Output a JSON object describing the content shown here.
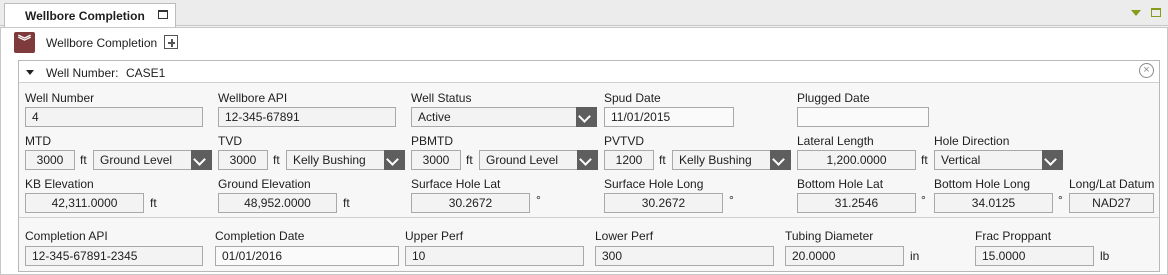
{
  "tab": {
    "title": "Wellbore Completion"
  },
  "section": {
    "title": "Wellbore Completion"
  },
  "group": {
    "label": "Well Number:",
    "value": "CASE1"
  },
  "fields": {
    "well_number": {
      "label": "Well Number",
      "value": "4"
    },
    "wellbore_api": {
      "label": "Wellbore API",
      "value": "12-345-67891"
    },
    "well_status": {
      "label": "Well Status",
      "value": "Active"
    },
    "spud_date": {
      "label": "Spud Date",
      "value": "11/01/2015"
    },
    "plugged_date": {
      "label": "Plugged Date",
      "value": ""
    },
    "mtd": {
      "label": "MTD",
      "value": "3000",
      "unit": "ft",
      "ref": "Ground Level"
    },
    "tvd": {
      "label": "TVD",
      "value": "3000",
      "unit": "ft",
      "ref": "Kelly Bushing"
    },
    "pbmtd": {
      "label": "PBMTD",
      "value": "3000",
      "unit": "ft",
      "ref": "Ground Level"
    },
    "pvtvd": {
      "label": "PVTVD",
      "value": "1200",
      "unit": "ft",
      "ref": "Kelly Bushing"
    },
    "lateral_length": {
      "label": "Lateral Length",
      "value": "1,200.0000",
      "unit": "ft"
    },
    "hole_direction": {
      "label": "Hole Direction",
      "value": "Vertical"
    },
    "kb_elevation": {
      "label": "KB Elevation",
      "value": "42,311.0000",
      "unit": "ft"
    },
    "ground_elevation": {
      "label": "Ground Elevation",
      "value": "48,952.0000",
      "unit": "ft"
    },
    "surface_hole_lat": {
      "label": "Surface Hole Lat",
      "value": "30.2672",
      "unit": "°"
    },
    "surface_hole_long": {
      "label": "Surface Hole Long",
      "value": "30.2672",
      "unit": "°"
    },
    "bottom_hole_lat": {
      "label": "Bottom Hole Lat",
      "value": "31.2546",
      "unit": "°"
    },
    "bottom_hole_long": {
      "label": "Bottom Hole Long",
      "value": "34.0125",
      "unit": "°"
    },
    "long_lat_datum": {
      "label": "Long/Lat Datum",
      "value": "NAD27"
    },
    "completion_api": {
      "label": "Completion API",
      "value": "12-345-67891-2345"
    },
    "completion_date": {
      "label": "Completion Date",
      "value": "01/01/2016"
    },
    "upper_perf": {
      "label": "Upper Perf",
      "value": "10"
    },
    "lower_perf": {
      "label": "Lower Perf",
      "value": "300"
    },
    "tubing_diameter": {
      "label": "Tubing Diameter",
      "value": "20.0000",
      "unit": "in"
    },
    "frac_proppant": {
      "label": "Frac Proppant",
      "value": "15.0000",
      "unit": "lb"
    }
  },
  "icons": {
    "collapse": "double-chevron-down-icon",
    "add": "add-icon",
    "close": "close-circle-icon",
    "dropdown": "chevron-down-icon"
  },
  "colors": {
    "accent": "#7f3b3b",
    "window_control": "#8a9a1a",
    "dropdown": "#5e5e5e"
  }
}
